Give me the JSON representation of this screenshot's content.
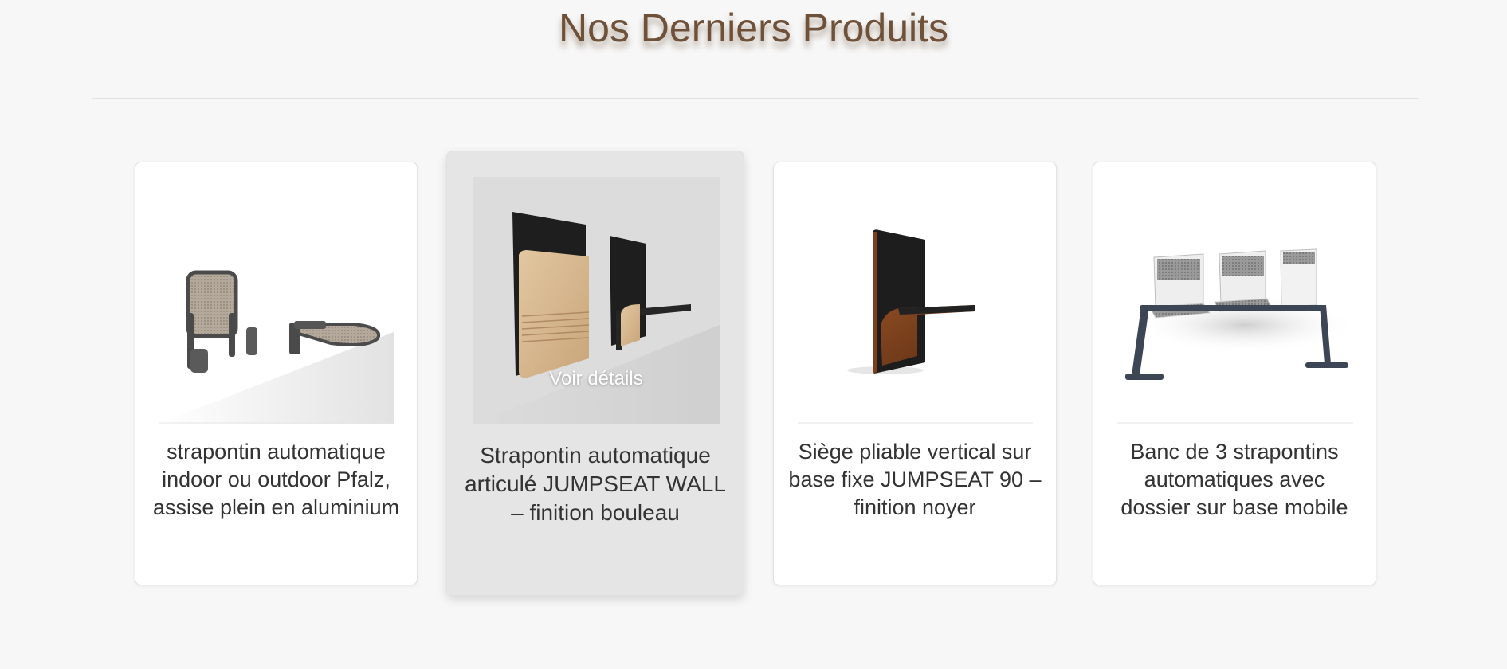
{
  "section": {
    "title": "Nos Derniers Produits"
  },
  "products": [
    {
      "title": "strapontin automatique indoor ou outdoor Pfalz, assise plein en aluminium",
      "image_icon": "folding-seat-metal-icon"
    },
    {
      "title": "Strapontin automatique articulé JUMPSEAT WALL – finition bouleau",
      "image_icon": "folding-seat-wall-birch-icon",
      "hover_label": "Voir détails"
    },
    {
      "title": "Siège pliable vertical sur base fixe JUMPSEAT 90 – finition noyer",
      "image_icon": "folding-seat-walnut-icon"
    },
    {
      "title": "Banc de 3 strapontins automatiques avec dossier sur base mobile",
      "image_icon": "bench-three-seats-icon"
    }
  ],
  "colors": {
    "title_brown": "#6e5138",
    "page_background": "#f7f7f7",
    "card_background": "#ffffff",
    "card_hover_background": "#e5e5e5",
    "text": "#333333"
  }
}
